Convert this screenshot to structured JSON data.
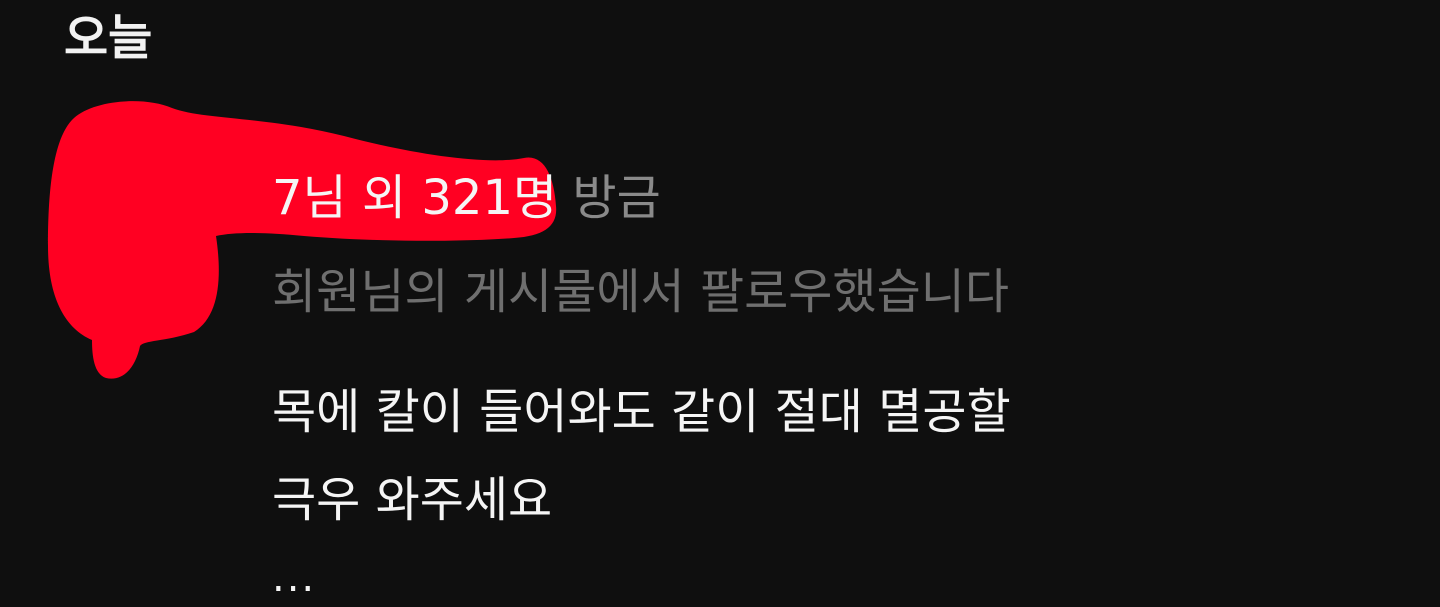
{
  "section": {
    "title": "오늘"
  },
  "notification": {
    "actor_suffix": "7님 외 321명",
    "time": "방금",
    "action_text": "회원님의 게시물에서 팔로우했습니다",
    "comment_lines": [
      "목에 칼이 들어와도 같이 절대 멸공할",
      "극우 와주세요"
    ],
    "more": "...",
    "redaction_color": "#ff0022"
  }
}
